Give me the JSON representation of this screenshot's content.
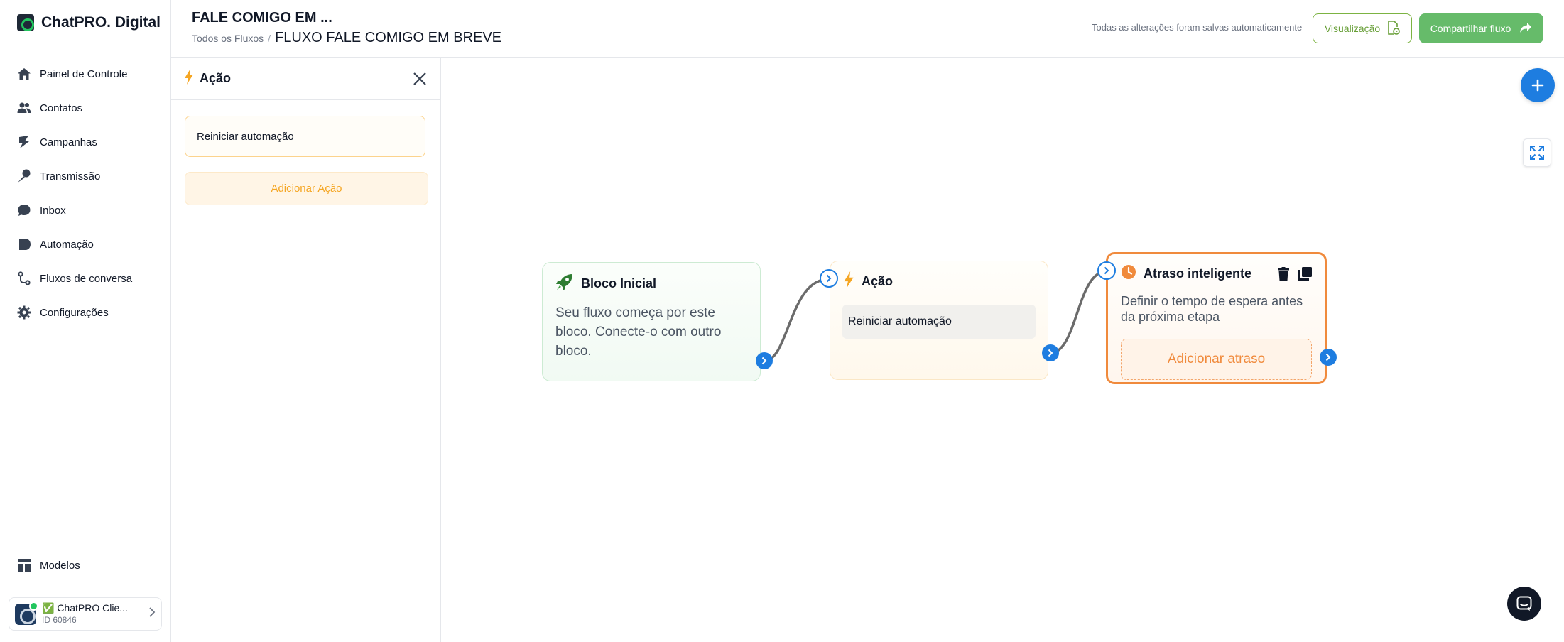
{
  "brand": {
    "name": "ChatPRO. Digital",
    "logo_icon": "chatpro-logo-icon"
  },
  "sidebar": {
    "items": [
      {
        "label": "Painel de Controle",
        "icon": "home-icon"
      },
      {
        "label": "Contatos",
        "icon": "users-icon"
      },
      {
        "label": "Campanhas",
        "icon": "campaign-icon"
      },
      {
        "label": "Transmissão",
        "icon": "broadcast-icon"
      },
      {
        "label": "Inbox",
        "icon": "chat-bubble-icon"
      },
      {
        "label": "Automação",
        "icon": "automation-icon"
      },
      {
        "label": "Fluxos de conversa",
        "icon": "flow-icon"
      },
      {
        "label": "Configurações",
        "icon": "gear-icon"
      }
    ],
    "bottom_item": {
      "label": "Modelos",
      "icon": "templates-icon"
    },
    "account": {
      "name": "✅ ChatPRO Clie...",
      "id": "ID 60846",
      "status_color": "#22c55e"
    }
  },
  "header": {
    "title": "FALE COMIGO EM ...",
    "breadcrumb": {
      "root": "Todos os Fluxos",
      "separator": "/",
      "current": "FLUXO FALE COMIGO EM BREVE"
    },
    "save_status": "Todas as alterações foram salvas automaticamente",
    "preview_label": "Visualização",
    "share_label": "Compartilhar fluxo"
  },
  "panel": {
    "title": "Ação",
    "action_item": "Reiniciar automação",
    "add_action_label": "Adicionar Ação"
  },
  "canvas": {
    "nodes": {
      "start": {
        "title": "Bloco Inicial",
        "description": "Seu fluxo começa por este bloco. Conecte-o com outro bloco."
      },
      "action": {
        "title": "Ação",
        "chip": "Reiniciar automação"
      },
      "delay": {
        "title": "Atraso inteligente",
        "description": "Definir o tempo de espera antes da próxima etapa",
        "add_label": "Adicionar atraso"
      }
    }
  },
  "colors": {
    "primary_blue": "#1e7de0",
    "green_accent": "#66bb6a",
    "orange_accent": "#f08a3c",
    "action_yellow": "#f5a623"
  }
}
